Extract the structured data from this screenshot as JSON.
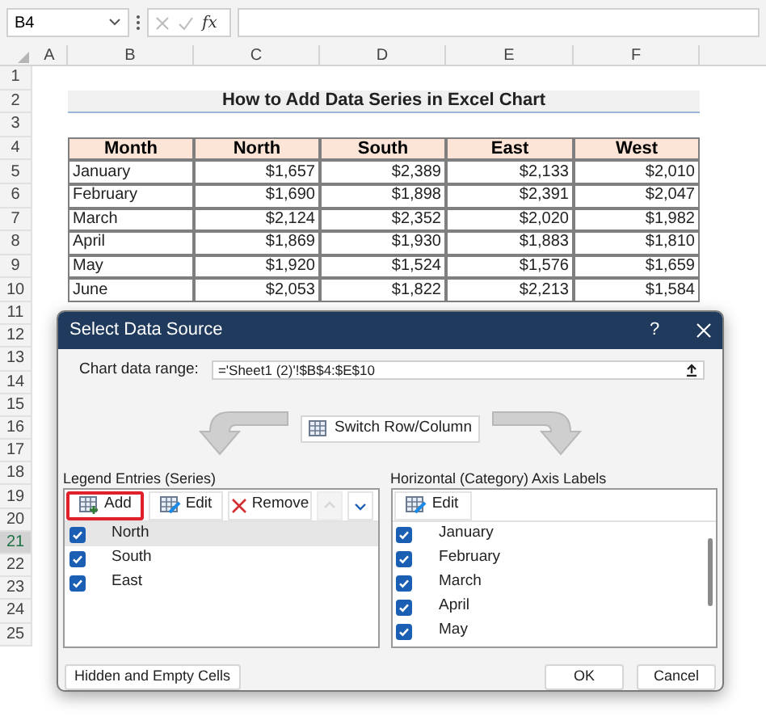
{
  "formula_bar": {
    "name_box": "B4",
    "function_label": "fx"
  },
  "column_headers": [
    "A",
    "B",
    "C",
    "D",
    "E",
    "F"
  ],
  "row_headers": [
    {
      "label": "1",
      "selected": false
    },
    {
      "label": "2",
      "selected": false
    },
    {
      "label": "3",
      "selected": false
    },
    {
      "label": "4",
      "selected": false
    },
    {
      "label": "5",
      "selected": false
    },
    {
      "label": "6",
      "selected": false
    },
    {
      "label": "7",
      "selected": false
    },
    {
      "label": "8",
      "selected": false
    },
    {
      "label": "9",
      "selected": false
    },
    {
      "label": "10",
      "selected": false
    },
    {
      "label": "11",
      "selected": false
    },
    {
      "label": "12",
      "selected": false
    },
    {
      "label": "13",
      "selected": false
    },
    {
      "label": "14",
      "selected": false
    },
    {
      "label": "15",
      "selected": false
    },
    {
      "label": "16",
      "selected": false
    },
    {
      "label": "17",
      "selected": false
    },
    {
      "label": "18",
      "selected": false
    },
    {
      "label": "19",
      "selected": false
    },
    {
      "label": "20",
      "selected": false
    },
    {
      "label": "21",
      "selected": true
    },
    {
      "label": "22",
      "selected": false
    },
    {
      "label": "23",
      "selected": false
    },
    {
      "label": "24",
      "selected": false
    },
    {
      "label": "25",
      "selected": false
    }
  ],
  "sheet_title": "How to Add Data Series in Excel Chart",
  "table": {
    "columns": [
      "Month",
      "North",
      "South",
      "East",
      "West"
    ],
    "rows": [
      [
        "January",
        "$1,657",
        "$2,389",
        "$2,133",
        "$2,010"
      ],
      [
        "February",
        "$1,690",
        "$1,898",
        "$2,391",
        "$2,047"
      ],
      [
        "March",
        "$2,124",
        "$2,352",
        "$2,020",
        "$1,982"
      ],
      [
        "April",
        "$1,869",
        "$1,930",
        "$1,883",
        "$1,810"
      ],
      [
        "May",
        "$1,920",
        "$1,524",
        "$1,576",
        "$1,659"
      ],
      [
        "June",
        "$2,053",
        "$1,822",
        "$2,213",
        "$1,584"
      ]
    ]
  },
  "dialog": {
    "title": "Select Data Source",
    "help": "?",
    "range_label": "Chart data range:",
    "range_value": "='Sheet1 (2)'!$B$4:$E$10",
    "switch_button": "Switch Row/Column",
    "legend": {
      "label": "Legend Entries (Series)",
      "toolbar": [
        {
          "kind": "add",
          "label": "Add",
          "highlighted": true
        },
        {
          "kind": "edit",
          "label": "Edit",
          "highlighted": false
        },
        {
          "kind": "remove",
          "label": "Remove",
          "highlighted": false
        },
        {
          "kind": "up",
          "disabled": true
        },
        {
          "kind": "down",
          "disabled": false
        }
      ],
      "series": [
        {
          "name": "North",
          "checked": true,
          "selected": true
        },
        {
          "name": "South",
          "checked": true,
          "selected": false
        },
        {
          "name": "East",
          "checked": true,
          "selected": false
        }
      ]
    },
    "axis": {
      "label": "Horizontal (Category) Axis Labels",
      "edit_button": "Edit",
      "categories": [
        {
          "name": "January",
          "checked": true
        },
        {
          "name": "February",
          "checked": true
        },
        {
          "name": "March",
          "checked": true
        },
        {
          "name": "April",
          "checked": true
        },
        {
          "name": "May",
          "checked": true
        }
      ]
    },
    "buttons": {
      "hidden_cells": "Hidden and Empty Cells",
      "ok": "OK",
      "cancel": "Cancel"
    }
  }
}
